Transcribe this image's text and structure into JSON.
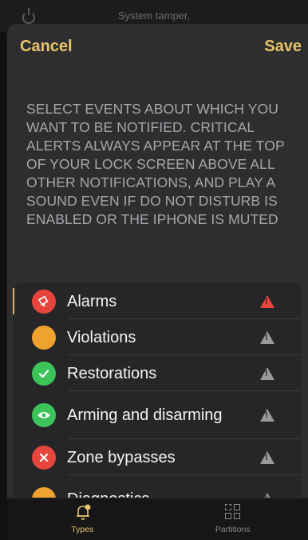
{
  "background": {
    "title": "System tamper,"
  },
  "nav": {
    "cancel_label": "Cancel",
    "save_label": "Save"
  },
  "description": "SELECT EVENTS ABOUT WHICH YOU WANT TO BE NOTIFIED. CRITICAL ALERTS ALWAYS APPEAR AT THE TOP OF YOUR LOCK SCREEN ABOVE ALL OTHER NOTIFICATIONS, AND PLAY A SOUND EVEN IF DO NOT DISTURB IS ENABLED OR THE IPHONE IS MUTED",
  "events": [
    {
      "label": "Alarms",
      "icon": "alarm-bell-icon",
      "color": "#e5453d",
      "critical": true
    },
    {
      "label": "Violations",
      "icon": "violation-dot-icon",
      "color": "#f0a22e",
      "critical": false
    },
    {
      "label": "Restorations",
      "icon": "checkmark-icon",
      "color": "#3cc45a",
      "critical": false
    },
    {
      "label": "Arming and disarming",
      "icon": "eye-icon",
      "color": "#3cc45a",
      "critical": false
    },
    {
      "label": "Zone bypasses",
      "icon": "cross-icon",
      "color": "#e5453d",
      "critical": false
    },
    {
      "label": "Diagnostics",
      "icon": "diagnostics-icon",
      "color": "#f0a22e",
      "critical": false
    }
  ],
  "tabs": [
    {
      "label": "Types",
      "icon": "bell-icon",
      "active": true
    },
    {
      "label": "Partitions",
      "icon": "grid-icon",
      "active": false
    }
  ],
  "colors": {
    "accent": "#e8c46a",
    "critical": "#e5453d",
    "warning": "#9a9a9d"
  }
}
